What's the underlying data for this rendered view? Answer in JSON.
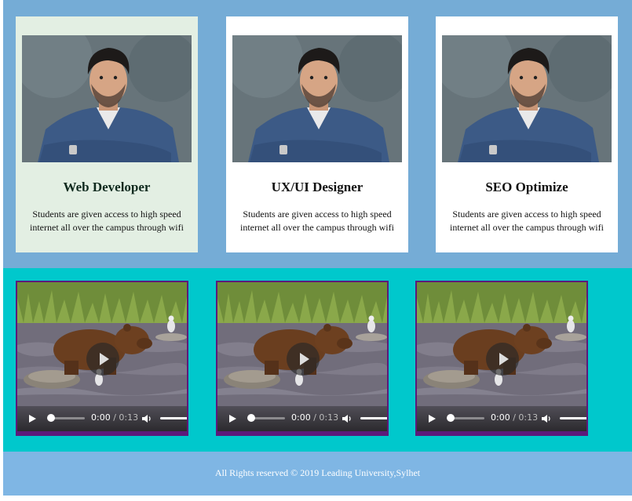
{
  "cards": [
    {
      "title": "Web Developer",
      "text": "Students are given access to high speed internet all over the campus through wifi"
    },
    {
      "title": "UX/UI Designer",
      "text": "Students are given access to high speed internet all over the campus through wifi"
    },
    {
      "title": "SEO Optimize",
      "text": "Students are given access to high speed internet all over the campus through wifi"
    }
  ],
  "videos": [
    {
      "current_time": "0:00",
      "duration": " / 0:13"
    },
    {
      "current_time": "0:00",
      "duration": " / 0:13"
    },
    {
      "current_time": "0:00",
      "duration": " / 0:13"
    }
  ],
  "footer": {
    "text": "All Rights reserved © 2019 Leading University,Sylhet"
  },
  "colors": {
    "cards_bg": "#75acd6",
    "highlight_card": "#e3efe3",
    "video_bg": "#00c8cc",
    "video_border": "#5c1a7a",
    "footer_bg": "#7fb6e4"
  }
}
